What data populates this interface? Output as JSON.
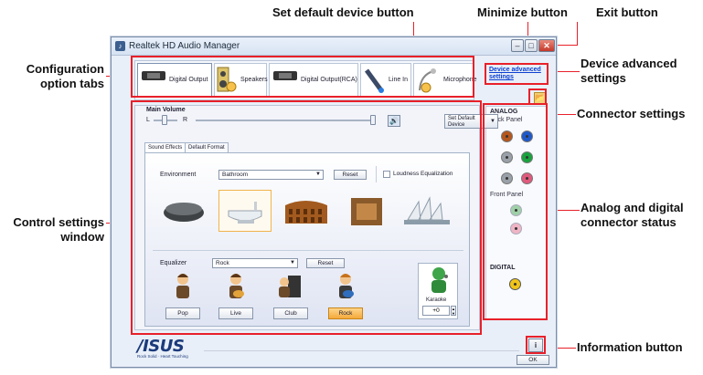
{
  "callouts": {
    "set_default": "Set default device button",
    "minimize": "Minimize button",
    "exit": "Exit button",
    "config_tabs_1": "Configuration",
    "config_tabs_2": "option tabs",
    "device_adv_1": "Device advanced",
    "device_adv_2": "settings",
    "connector_settings": "Connector settings",
    "control_window_1": "Control settings",
    "control_window_2": "window",
    "analog_status_1": "Analog and digital",
    "analog_status_2": "connector status",
    "information": "Information button"
  },
  "window": {
    "title": "Realtek HD Audio Manager",
    "minimize_glyph": "–",
    "maximize_glyph": "□",
    "close_glyph": "✕"
  },
  "tabs": [
    {
      "label": "Digital Output",
      "icon": "digital-output-icon"
    },
    {
      "label": "Speakers",
      "icon": "speakers-icon"
    },
    {
      "label": "Digital Output(RCA)",
      "icon": "digital-output-rca-icon"
    },
    {
      "label": "Line In",
      "icon": "line-in-icon"
    },
    {
      "label": "Microphone",
      "icon": "microphone-icon"
    }
  ],
  "device_advanced": {
    "line1": "Device advanced",
    "line2": "settings"
  },
  "connector_settings_glyph": "📂",
  "connector": {
    "analog": "ANALOG",
    "back_panel": "Back Panel",
    "front_panel": "Front Panel",
    "digital": "DIGITAL",
    "colors": {
      "orange": "#b5561c",
      "blue": "#1f59c9",
      "gray": "#9aa0a8",
      "green": "#19a23e",
      "pink": "#e05a7c",
      "front_green": "#9fd0a8",
      "front_pink": "#efb5c4",
      "digital": "#f0c419"
    }
  },
  "volume": {
    "label": "Main Volume",
    "left": "L",
    "right": "R",
    "set_default_line1": "Set Default",
    "set_default_line2": "Device",
    "speaker_glyph": "🔊",
    "dropdown_glyph": "▼"
  },
  "subtabs": {
    "sound_effects": "Sound Effects",
    "default_format": "Default Format"
  },
  "environment": {
    "label": "Environment",
    "value": "Bathroom",
    "reset": "Reset",
    "loudness": "Loudness Equalization"
  },
  "equalizer": {
    "label": "Equalizer",
    "value": "Rock",
    "reset": "Reset",
    "presets": [
      "Pop",
      "Live",
      "Club",
      "Rock"
    ],
    "active": "Rock"
  },
  "karaoke": {
    "label": "Karaoke",
    "value": "+0",
    "up": "▲",
    "down": "▼"
  },
  "footer": {
    "logo": "/ISUS",
    "tagline": "Rock Solid · Heart Touching",
    "info_glyph": "i",
    "ok": "OK"
  }
}
